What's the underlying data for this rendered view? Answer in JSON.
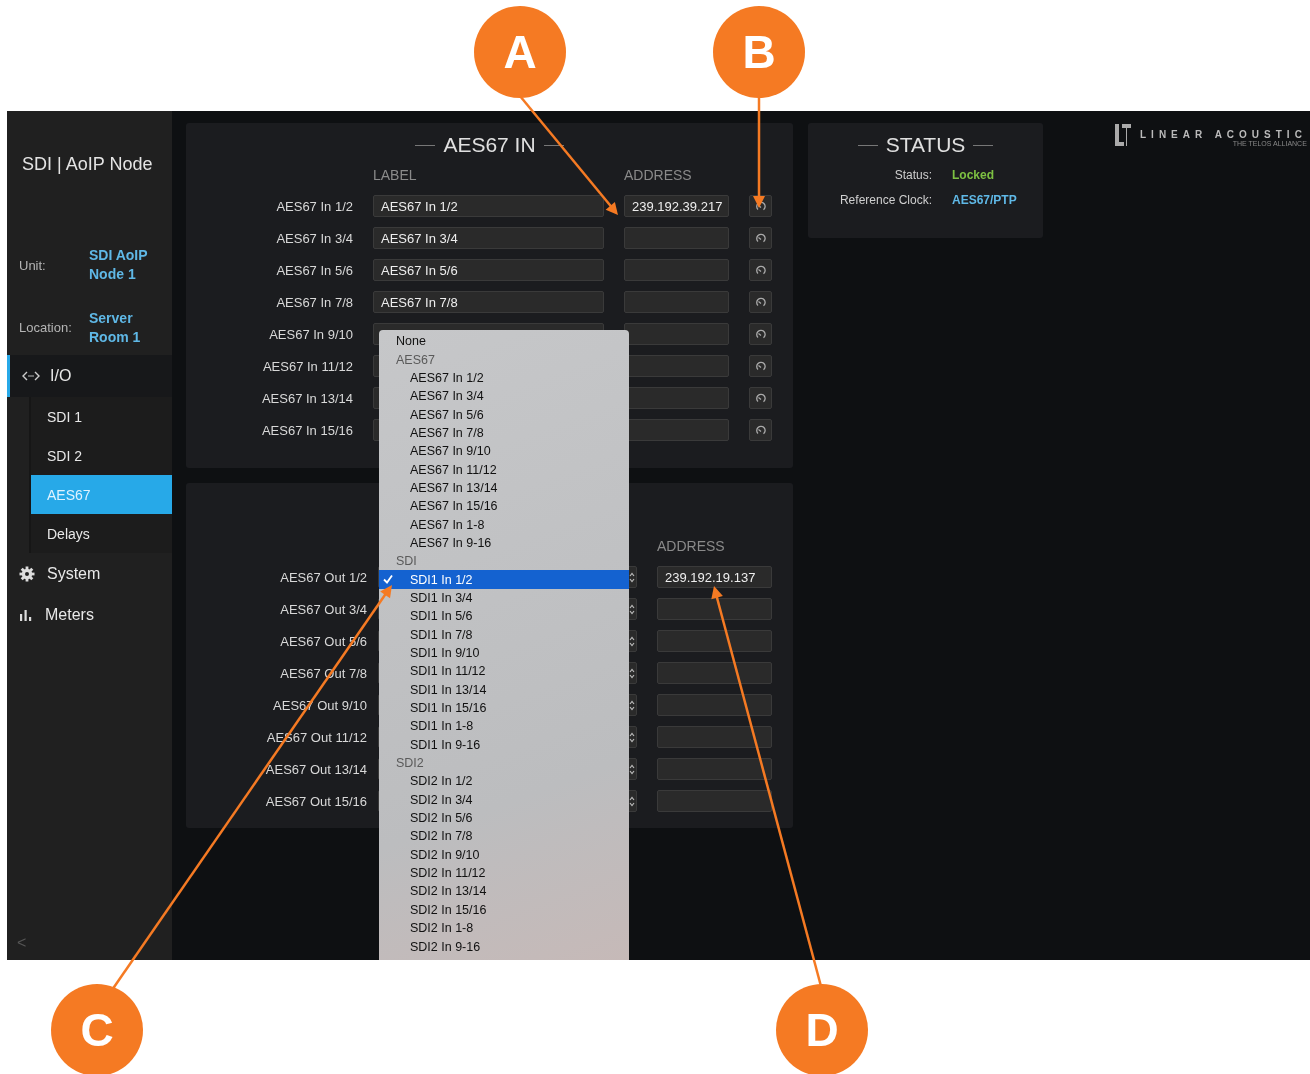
{
  "callouts": [
    {
      "letter": "A"
    },
    {
      "letter": "B"
    },
    {
      "letter": "C"
    },
    {
      "letter": "D"
    }
  ],
  "sidebar": {
    "title": "SDI | AoIP Node",
    "info": [
      {
        "label": "Unit:",
        "value": "SDI AoIP Node 1"
      },
      {
        "label": "Location:",
        "value": "Server Room 1"
      }
    ],
    "nav": [
      {
        "label": "I/O",
        "expanded": true,
        "children": [
          {
            "label": "SDI 1",
            "selected": false
          },
          {
            "label": "SDI 2",
            "selected": false
          },
          {
            "label": "AES67",
            "selected": true
          },
          {
            "label": "Delays",
            "selected": false
          }
        ]
      },
      {
        "label": "System"
      },
      {
        "label": "Meters"
      }
    ],
    "collapse": "<"
  },
  "aes67_in": {
    "title": "AES67 IN",
    "columns": [
      "LABEL",
      "ADDRESS"
    ],
    "rows": [
      {
        "name": "AES67 In 1/2",
        "label": "AES67 In 1/2",
        "address": "239.192.39.217"
      },
      {
        "name": "AES67 In 3/4",
        "label": "AES67 In 3/4"
      },
      {
        "name": "AES67 In 5/6",
        "label": "AES67 In 5/6"
      },
      {
        "name": "AES67 In 7/8",
        "label": "AES67 In 7/8"
      },
      {
        "name": "AES67 In 9/10"
      },
      {
        "name": "AES67 In 11/12"
      },
      {
        "name": "AES67 In 13/14"
      },
      {
        "name": "AES67 In 15/16"
      }
    ]
  },
  "aes67_out": {
    "columns": [
      "ADDRESS"
    ],
    "rows": [
      {
        "name": "AES67 Out 1/2",
        "address": "239.192.19.137"
      },
      {
        "name": "AES67 Out 3/4"
      },
      {
        "name": "AES67 Out 5/6"
      },
      {
        "name": "AES67 Out 7/8"
      },
      {
        "name": "AES67 Out 9/10"
      },
      {
        "name": "AES67 Out 11/12"
      },
      {
        "name": "AES67 Out 13/14"
      },
      {
        "name": "AES67 Out 15/16"
      }
    ]
  },
  "status": {
    "title": "STATUS",
    "fields": [
      {
        "label": "Status:",
        "value": "Locked",
        "color": "#7dc142"
      },
      {
        "label": "Reference Clock:",
        "value": "AES67/PTP",
        "color": "#5fb8e6"
      }
    ]
  },
  "logo": {
    "name": "LINEAR ACOUSTIC",
    "tagline": "THE TELOS ALLIANCE"
  },
  "dropdown": {
    "items": [
      {
        "kind": "option",
        "label": "None",
        "selected": false
      },
      {
        "kind": "group",
        "label": "AES67",
        "children": [
          {
            "label": "AES67 In 1/2",
            "selected": false
          },
          {
            "label": "AES67 In 3/4",
            "selected": false
          },
          {
            "label": "AES67 In 5/6",
            "selected": false
          },
          {
            "label": "AES67 In 7/8",
            "selected": false
          },
          {
            "label": "AES67 In 9/10",
            "selected": false
          },
          {
            "label": "AES67 In 11/12",
            "selected": false
          },
          {
            "label": "AES67 In 13/14",
            "selected": false
          },
          {
            "label": "AES67 In 15/16",
            "selected": false
          },
          {
            "label": "AES67 In 1-8",
            "selected": false
          },
          {
            "label": "AES67 In 9-16",
            "selected": false
          }
        ]
      },
      {
        "kind": "group",
        "label": "SDI",
        "children": [
          {
            "label": "SDI1 In 1/2",
            "selected": true
          },
          {
            "label": "SDI1 In 3/4",
            "selected": false
          },
          {
            "label": "SDI1 In 5/6",
            "selected": false
          },
          {
            "label": "SDI1 In 7/8",
            "selected": false
          },
          {
            "label": "SDI1 In 9/10",
            "selected": false
          },
          {
            "label": "SDI1 In 11/12",
            "selected": false
          },
          {
            "label": "SDI1 In 13/14",
            "selected": false
          },
          {
            "label": "SDI1 In 15/16",
            "selected": false
          },
          {
            "label": "SDI1 In 1-8",
            "selected": false
          },
          {
            "label": "SDI1 In 9-16",
            "selected": false
          }
        ]
      },
      {
        "kind": "group",
        "label": "SDI2",
        "children": [
          {
            "label": "SDI2 In 1/2",
            "selected": false
          },
          {
            "label": "SDI2 In 3/4",
            "selected": false
          },
          {
            "label": "SDI2 In 5/6",
            "selected": false
          },
          {
            "label": "SDI2 In 7/8",
            "selected": false
          },
          {
            "label": "SDI2 In 9/10",
            "selected": false
          },
          {
            "label": "SDI2 In 11/12",
            "selected": false
          },
          {
            "label": "SDI2 In 13/14",
            "selected": false
          },
          {
            "label": "SDI2 In 15/16",
            "selected": false
          },
          {
            "label": "SDI2 In 1-8",
            "selected": false
          },
          {
            "label": "SDI2 In 9-16",
            "selected": false
          }
        ]
      }
    ]
  }
}
